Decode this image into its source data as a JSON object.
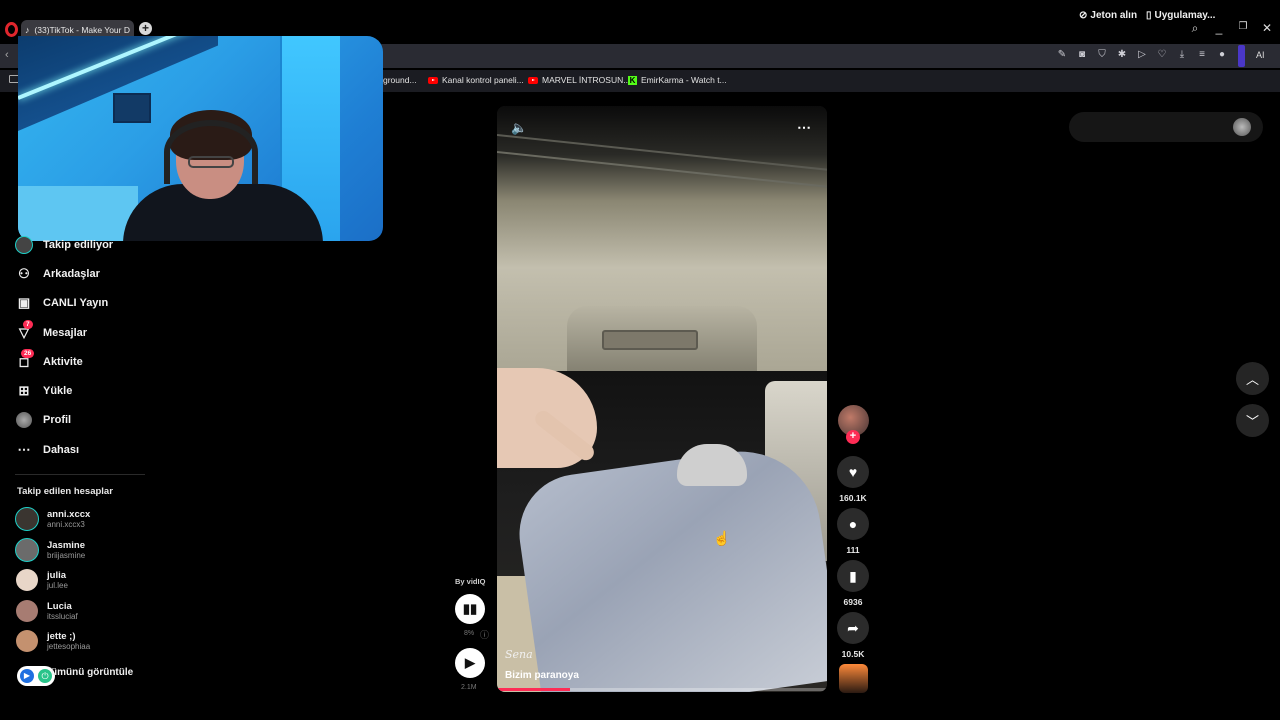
{
  "browser": {
    "tab_title": "(33)TikTok - Make Your D",
    "new_tab_symbol": "+",
    "bookmarks": [
      {
        "label": "ground...",
        "icon": "none"
      },
      {
        "label": "Kanal kontrol paneli...",
        "icon": "youtube-icon"
      },
      {
        "label": "MARVEL İNTROSUN...",
        "icon": "youtube-icon"
      },
      {
        "label": "EmirKarma - Watch t...",
        "icon": "kick-icon"
      }
    ],
    "ai_label": "AI"
  },
  "sidebar": {
    "items": [
      {
        "label": "Takip ediliyor",
        "icon": "avatar-icon"
      },
      {
        "label": "Arkadaşlar",
        "icon": "friends-icon"
      },
      {
        "label": "CANLI Yayın",
        "icon": "live-icon"
      },
      {
        "label": "Mesajlar",
        "icon": "messages-icon",
        "badge": "7"
      },
      {
        "label": "Aktivite",
        "icon": "activity-icon",
        "badge": "26"
      },
      {
        "label": "Yükle",
        "icon": "upload-icon"
      },
      {
        "label": "Profil",
        "icon": "profile-icon"
      },
      {
        "label": "Dahası",
        "icon": "more-icon"
      }
    ],
    "following_title": "Takip edilen hesaplar",
    "accounts": [
      {
        "name": "anni.xccx",
        "handle": "anni.xccx3"
      },
      {
        "name": "Jasmine",
        "handle": "briijasmine"
      },
      {
        "name": "julia",
        "handle": "jul.lee"
      },
      {
        "name": "Lucia",
        "handle": "itssluciaf"
      },
      {
        "name": "jette ;)",
        "handle": "jettesophiaa"
      }
    ],
    "see_all": "ümünü görüntüle"
  },
  "video": {
    "creator_handle": "Sena",
    "caption": "Bizim paranoya",
    "progress": 0.22
  },
  "actions": {
    "likes": "160.1K",
    "comments": "111",
    "saves": "6936",
    "shares": "10.5K"
  },
  "vidiq": {
    "by_label": "By vidIQ",
    "percent": "8%",
    "views": "2.1M"
  },
  "header_right": {
    "coins": "Jeton alın",
    "app": "Uygulamay..."
  }
}
